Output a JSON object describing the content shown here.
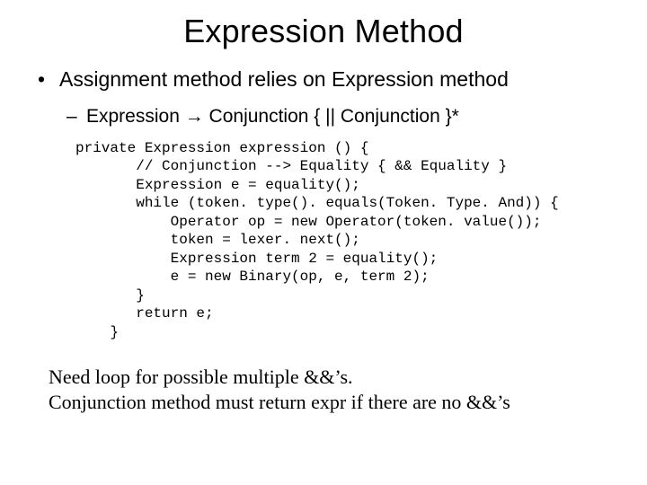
{
  "title": "Expression Method",
  "bullets": {
    "l1": "Assignment method relies on Expression method",
    "l2_prefix": "Expression ",
    "l2_arrow": "→",
    "l2_suffix": " Conjunction { || Conjunction }*"
  },
  "code": "private Expression expression () {\n       // Conjunction --> Equality { && Equality }\n       Expression e = equality();\n       while (token. type(). equals(Token. Type. And)) {\n           Operator op = new Operator(token. value());\n           token = lexer. next();\n           Expression term 2 = equality();\n           e = new Binary(op, e, term 2);\n       }\n       return e;\n    }",
  "footer": {
    "line1": "Need loop for possible multiple &&’s.",
    "line2": "Conjunction method must return expr if there are no &&’s"
  }
}
